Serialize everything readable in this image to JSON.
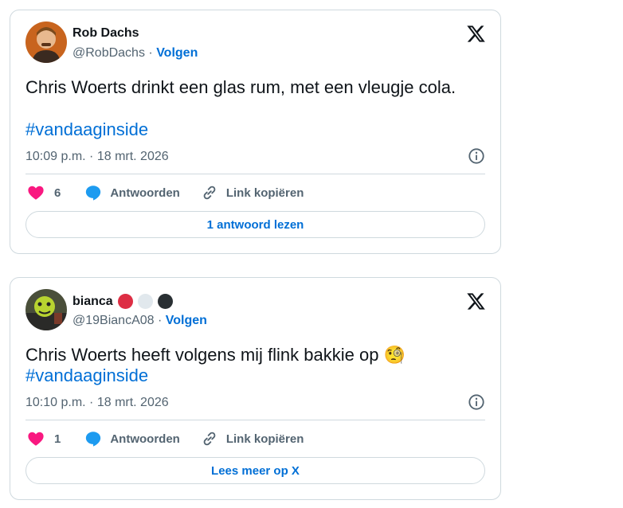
{
  "tweets": [
    {
      "name": "Rob Dachs",
      "handle": "@RobDachs",
      "separator": "·",
      "follow": "Volgen",
      "text": "Chris Woerts drinkt een glas rum, met een vleugje cola.",
      "hashtag": "#vandaaginside",
      "time": "10:09 p.m. · 18 mrt. 2026",
      "likes": "6",
      "reply_label": "Antwoorden",
      "copy_link_label": "Link kopiëren",
      "button_label": "1 antwoord lezen"
    },
    {
      "name": "bianca",
      "handle": "@19BiancA08",
      "separator": "·",
      "follow": "Volgen",
      "text": "Chris Woerts heeft volgens mij flink bakkie op",
      "emoji": "🧐",
      "hashtag": "#vandaaginside",
      "time": "10:10 p.m. · 18 mrt. 2026",
      "likes": "1",
      "reply_label": "Antwoorden",
      "copy_link_label": "Link kopiëren",
      "button_label": "Lees meer op X",
      "name_dots": [
        "#dd2e44",
        "#e1e8ed",
        "#292f33"
      ]
    }
  ],
  "colors": {
    "link": "#006fd6",
    "muted": "#536471",
    "heart": "#f91880",
    "border": "#cfd9de"
  }
}
